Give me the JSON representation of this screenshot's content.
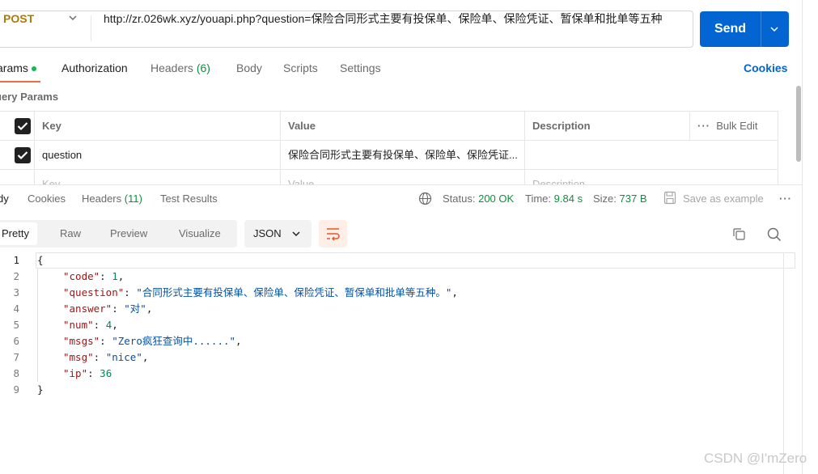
{
  "request": {
    "method": "POST",
    "url": "http://zr.026wk.xyz/youapi.php?question=保险合同形式主要有投保单、保险单、保险凭证、暂保单和批单等五种",
    "send_label": "Send"
  },
  "request_tabs": {
    "params": "arams",
    "authorization": "Authorization",
    "headers": "Headers",
    "headers_count": "(6)",
    "body": "Body",
    "scripts": "Scripts",
    "settings": "Settings",
    "cookies": "Cookies"
  },
  "query_params": {
    "title": "uery Params",
    "headers": {
      "key": "Key",
      "value": "Value",
      "description": "Description",
      "bulk_edit": "Bulk Edit"
    },
    "rows": [
      {
        "enabled": true,
        "key": "question",
        "value": "保险合同形式主要有投保单、保险单、保险凭证...",
        "description": ""
      }
    ],
    "placeholder": {
      "key": "Key",
      "value": "Value",
      "description": "Description"
    }
  },
  "response_tabs": {
    "body": "dy",
    "cookies": "Cookies",
    "headers": "Headers",
    "headers_count": "(11)",
    "test_results": "Test Results"
  },
  "response_status": {
    "status_label": "Status:",
    "status_value": "200 OK",
    "time_label": "Time:",
    "time_value": "9.84 s",
    "size_label": "Size:",
    "size_value": "737 B",
    "save_example": "Save as example"
  },
  "format_bar": {
    "pretty": "Pretty",
    "raw": "Raw",
    "preview": "Preview",
    "visualize": "Visualize",
    "language": "JSON"
  },
  "code": {
    "line_numbers": [
      "1",
      "2",
      "3",
      "4",
      "5",
      "6",
      "7",
      "8",
      "9"
    ],
    "open_brace": "{",
    "close_brace": "}",
    "fields": [
      {
        "key": "\"code\"",
        "value": "1",
        "type": "number",
        "comma": ","
      },
      {
        "key": "\"question\"",
        "value": "\"合同形式主要有投保单、保险单、保险凭证、暂保单和批单等五种。\"",
        "type": "string",
        "comma": ","
      },
      {
        "key": "\"answer\"",
        "value": "\"对\"",
        "type": "string",
        "comma": ","
      },
      {
        "key": "\"num\"",
        "value": "4",
        "type": "number",
        "comma": ","
      },
      {
        "key": "\"msgs\"",
        "value": "\"Zero疯狂查询中......\"",
        "type": "string",
        "comma": ","
      },
      {
        "key": "\"msg\"",
        "value": "\"nice\"",
        "type": "string",
        "comma": ","
      },
      {
        "key": "\"ip\"",
        "value": "36",
        "type": "number",
        "comma": ""
      }
    ]
  },
  "watermark": "CSDN @I'mZero",
  "colors": {
    "method": "#ad7a03",
    "send": "#0265d2",
    "active_tab_underline": "#f26b3a",
    "status_ok": "#0f8f3e",
    "json_key": "#a31515",
    "json_string": "#0451a5",
    "json_number": "#098658"
  }
}
